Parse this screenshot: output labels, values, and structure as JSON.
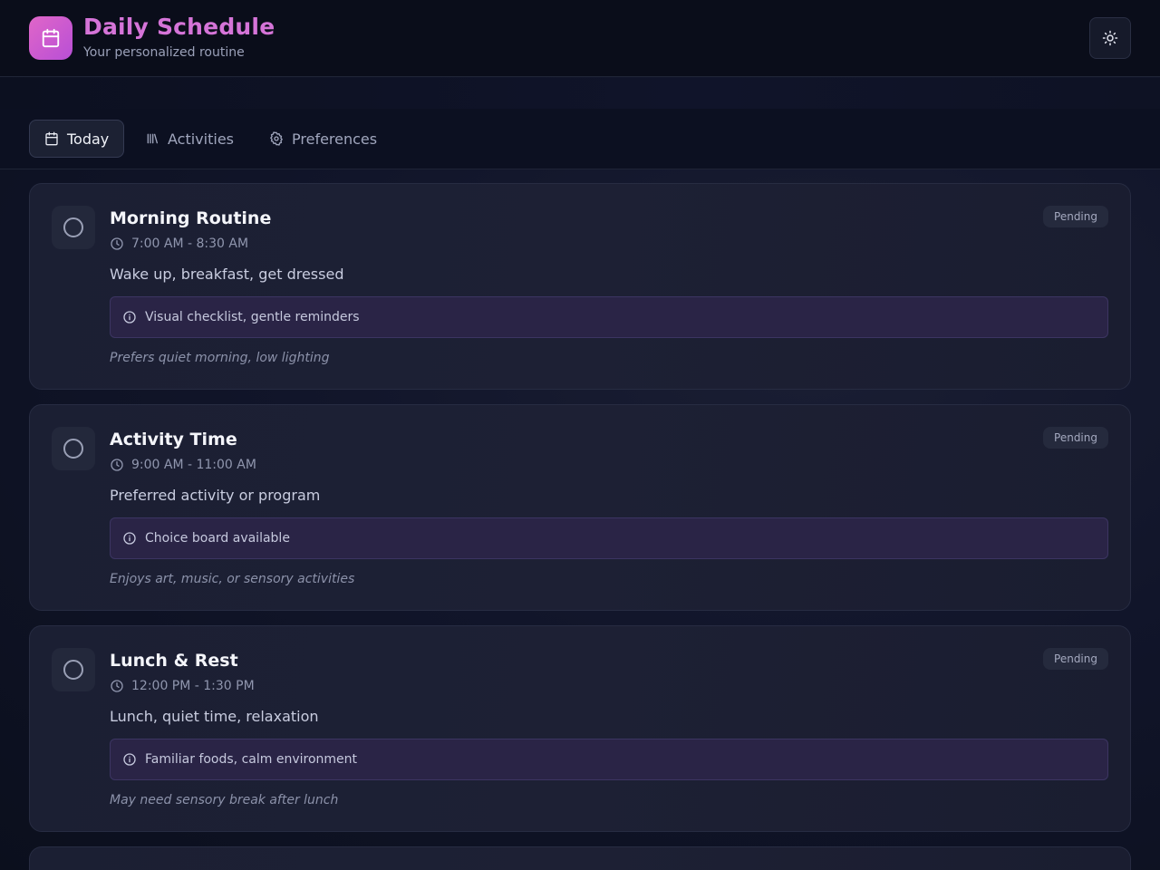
{
  "header": {
    "title": "Daily Schedule",
    "subtitle": "Your personalized routine",
    "logo_icon": "calendar-icon",
    "theme_toggle_icon": "sun-icon"
  },
  "tabs": [
    {
      "label": "Today",
      "icon": "calendar-icon",
      "active": true
    },
    {
      "label": "Activities",
      "icon": "library-icon",
      "active": false
    },
    {
      "label": "Preferences",
      "icon": "gear-icon",
      "active": false
    }
  ],
  "schedule": [
    {
      "title": "Morning Routine",
      "time": "7:00 AM - 8:30 AM",
      "description": "Wake up, breakfast, get dressed",
      "support": "Visual checklist, gentle reminders",
      "note": "Prefers quiet morning, low lighting",
      "status": "Pending"
    },
    {
      "title": "Activity Time",
      "time": "9:00 AM - 11:00 AM",
      "description": "Preferred activity or program",
      "support": "Choice board available",
      "note": "Enjoys art, music, or sensory activities",
      "status": "Pending"
    },
    {
      "title": "Lunch & Rest",
      "time": "12:00 PM - 1:30 PM",
      "description": "Lunch, quiet time, relaxation",
      "support": "Familiar foods, calm environment",
      "note": "May need sensory break after lunch",
      "status": "Pending"
    }
  ],
  "colors": {
    "accent": "#d574d8",
    "background": "#0d1120",
    "card": "#1c1f33",
    "support_bg": "#2a2446"
  }
}
